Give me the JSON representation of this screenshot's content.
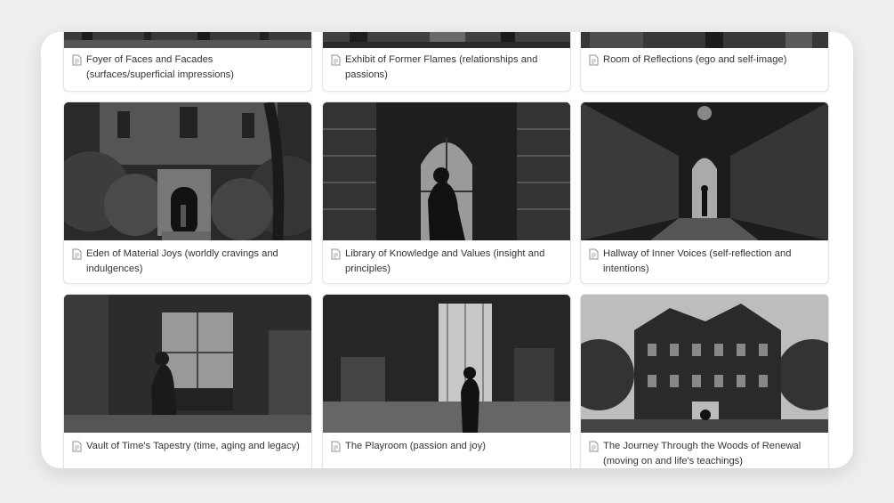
{
  "gallery": {
    "cards": [
      {
        "title": "Foyer of Faces and Facades (surfaces/superficial impressions)",
        "icon": "page-icon"
      },
      {
        "title": "Exhibit of Former Flames (relationships and passions)",
        "icon": "page-icon"
      },
      {
        "title": "Room of Reflections (ego and self-image)",
        "icon": "page-icon"
      },
      {
        "title": "Eden of Material Joys (worldly cravings and indulgences)",
        "icon": "page-icon"
      },
      {
        "title": "Library of Knowledge and Values (insight and principles)",
        "icon": "page-icon"
      },
      {
        "title": "Hallway of Inner Voices (self-reflection and intentions)",
        "icon": "page-icon"
      },
      {
        "title": "Vault of Time's Tapestry (time, aging and legacy)",
        "icon": "page-icon"
      },
      {
        "title": "The Playroom (passion and joy)",
        "icon": "page-icon"
      },
      {
        "title": "The Journey Through the Woods of Renewal (moving on and life's teachings)",
        "icon": "page-icon"
      }
    ]
  }
}
